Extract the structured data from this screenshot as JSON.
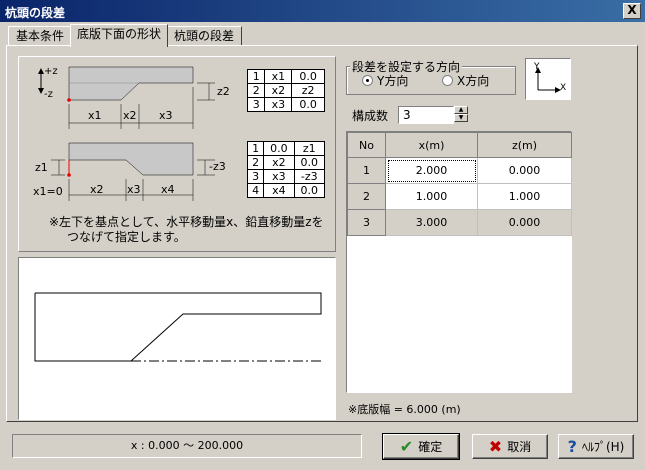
{
  "window": {
    "title": "杭頭の段差",
    "close_glyph": "X"
  },
  "tabs": [
    {
      "label": "基本条件"
    },
    {
      "label": "底版下面の形状"
    },
    {
      "label": "杭頭の段差"
    }
  ],
  "diagram1": {
    "plus_z": "+z",
    "minus_z": "-z",
    "labels": {
      "x1": "x1",
      "x2": "x2",
      "x3": "x3",
      "z2": "z2"
    }
  },
  "table1": [
    [
      "1",
      "x1",
      "0.0"
    ],
    [
      "2",
      "x2",
      "z2"
    ],
    [
      "3",
      "x3",
      "0.0"
    ]
  ],
  "diagram2": {
    "labels": {
      "z1": "z1",
      "x1eq0": "x1=0",
      "x2": "x2",
      "x3": "x3",
      "x4": "x4",
      "minus_z3": "-z3"
    }
  },
  "table2": [
    [
      "1",
      "0.0",
      "z1"
    ],
    [
      "2",
      "x2",
      "0.0"
    ],
    [
      "3",
      "x3",
      "-z3"
    ],
    [
      "4",
      "x4",
      "0.0"
    ]
  ],
  "note": {
    "line1": "※左下を基点として、水平移動量x、鉛直移動量zを",
    "line2": "つなげて指定します。"
  },
  "direction": {
    "group_label": "段差を設定する方向",
    "option_y": "Y方向",
    "option_x": "X方向",
    "selected": "Y方向"
  },
  "axis_icon": {
    "y": "Y",
    "x": "X"
  },
  "count": {
    "label": "構成数",
    "value": "3"
  },
  "grid": {
    "headers": [
      "No",
      "x(m)",
      "z(m)"
    ],
    "rows": [
      {
        "no": "1",
        "x": "2.000",
        "z": "0.000"
      },
      {
        "no": "2",
        "x": "1.000",
        "z": "1.000"
      },
      {
        "no": "3",
        "x": "3.000",
        "z": "0.000"
      }
    ]
  },
  "footer_note": "※底版幅 = 6.000 (m)",
  "status": "x : 0.000 ～ 200.000",
  "buttons": {
    "ok": "確定",
    "cancel": "取消",
    "help": "ﾍﾙﾌﾟ(H)"
  }
}
